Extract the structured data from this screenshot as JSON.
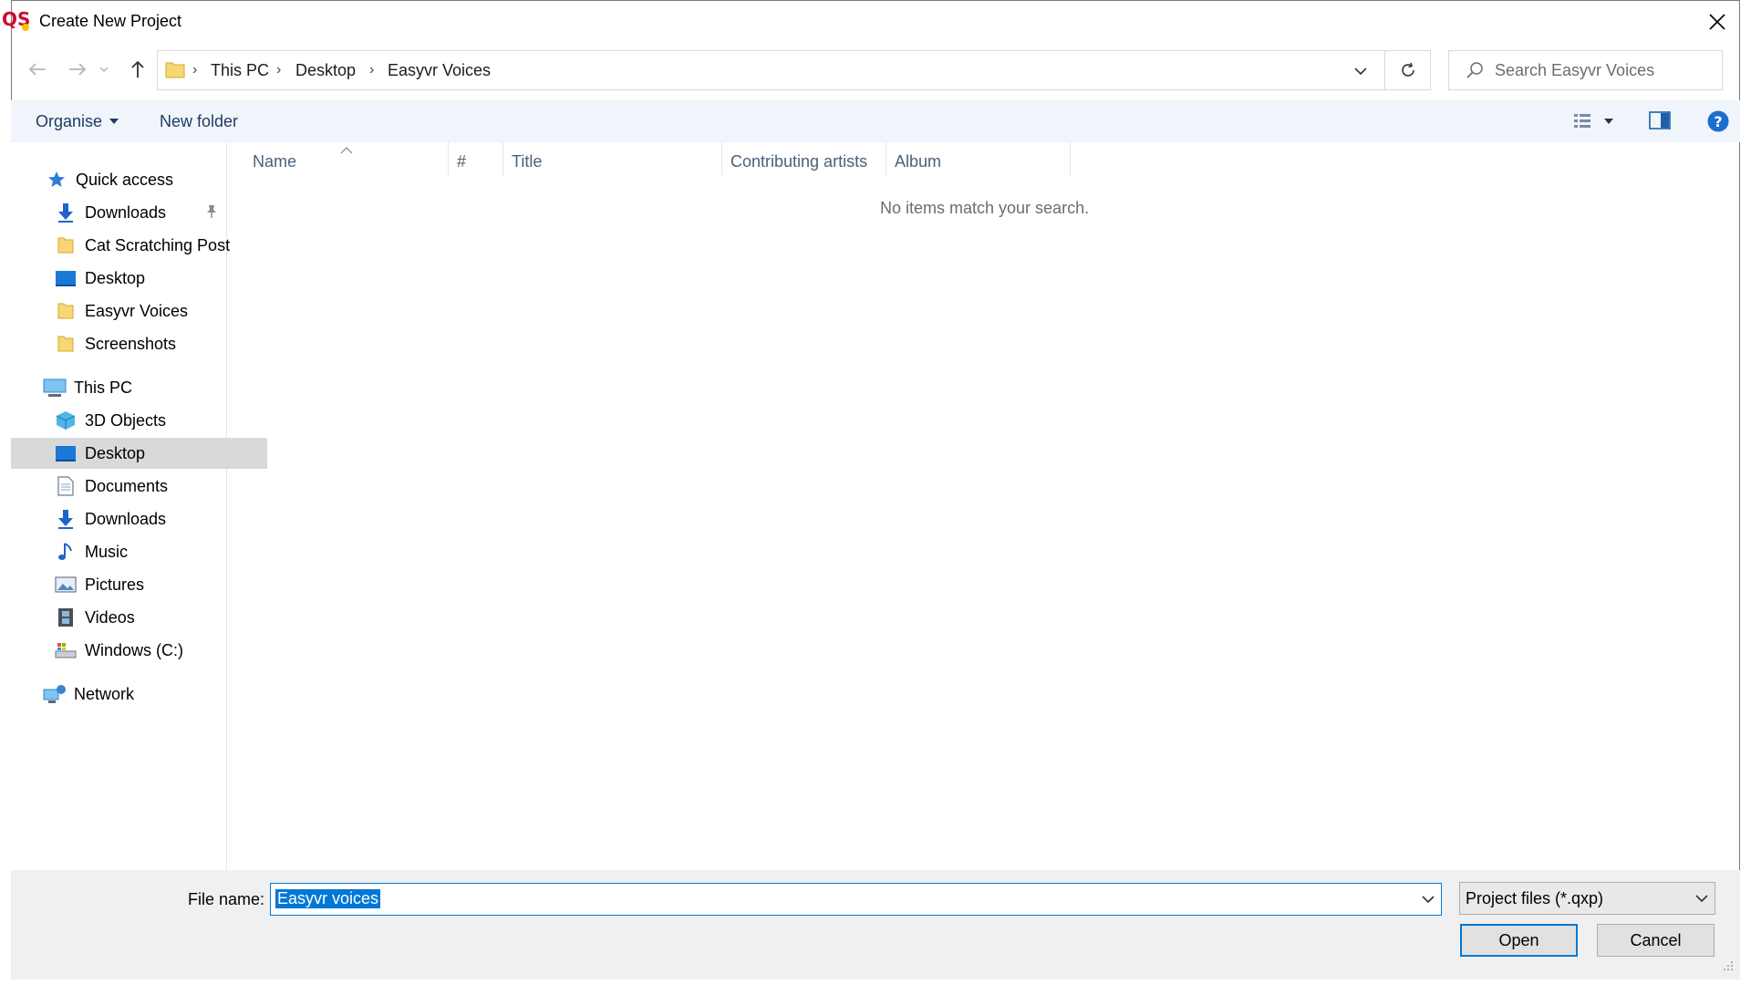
{
  "window": {
    "title": "Create New Project"
  },
  "nav": {
    "back_icon": "arrow-left-icon",
    "forward_icon": "arrow-right-icon",
    "recent_icon": "chevron-down-icon",
    "up_icon": "arrow-up-icon",
    "breadcrumbs": [
      "This PC",
      "Desktop",
      "Easyvr Voices"
    ],
    "search_placeholder": "Search Easyvr Voices"
  },
  "toolbar": {
    "organise_label": "Organise",
    "new_folder_label": "New folder"
  },
  "sidebar": {
    "quick_access": "Quick access",
    "quick_items": [
      "Downloads",
      "Cat Scratching Post",
      "Desktop",
      "Easyvr Voices",
      "Screenshots"
    ],
    "this_pc": "This PC",
    "pc_items": [
      "3D Objects",
      "Desktop",
      "Documents",
      "Downloads",
      "Music",
      "Pictures",
      "Videos",
      "Windows (C:)"
    ],
    "network": "Network"
  },
  "columns": [
    "Name",
    "#",
    "Title",
    "Contributing artists",
    "Album"
  ],
  "empty_message": "No items match your search.",
  "footer": {
    "file_name_label": "File name:",
    "file_name_value": "Easyvr voices",
    "file_type_value": "Project files (*.qxp)",
    "open_label": "Open",
    "cancel_label": "Cancel"
  },
  "colors": {
    "accent": "#0078d7",
    "toolbar_bg": "#f0f5fb",
    "selected_bg": "#d9d9d9",
    "footer_bg": "#f0f0f0",
    "folder": "#f7d774"
  }
}
